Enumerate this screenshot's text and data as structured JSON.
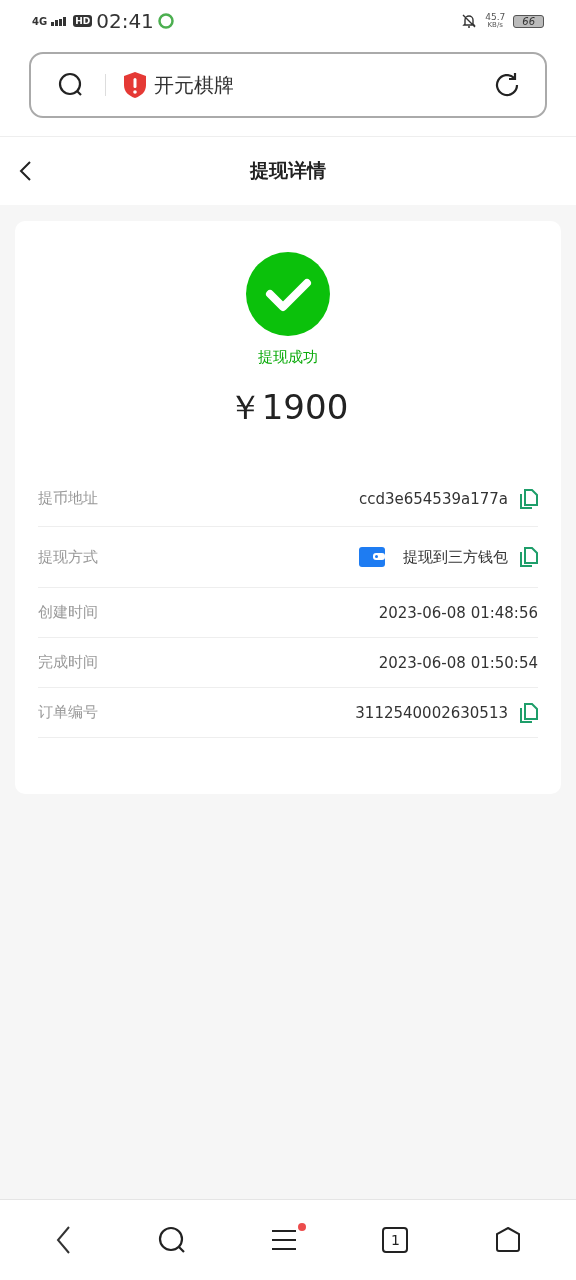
{
  "status_bar": {
    "network": "4G",
    "hd": "HD",
    "time": "02:41",
    "speed": "45.7",
    "speed_unit": "KB/s",
    "battery": "66"
  },
  "address_bar": {
    "text": "开元棋牌",
    "warning": true
  },
  "header": {
    "title": "提现详情"
  },
  "result": {
    "status": "提现成功",
    "success": true,
    "amount": "￥1900"
  },
  "details": [
    {
      "label": "提币地址",
      "value": "ccd3e654539a177a",
      "kind": "text",
      "copyable": true
    },
    {
      "label": "提现方式",
      "value": "提现到三方钱包",
      "kind": "wallet",
      "copyable": true
    },
    {
      "label": "创建时间",
      "value": "2023-06-08 01:48:56",
      "kind": "text",
      "copyable": false
    },
    {
      "label": "完成时间",
      "value": "2023-06-08 01:50:54",
      "kind": "text",
      "copyable": false
    },
    {
      "label": "订单编号",
      "value": "3112540002630513",
      "kind": "text",
      "copyable": true
    }
  ],
  "bottom_nav": {
    "tab_count": "1",
    "menu_badge": true
  }
}
